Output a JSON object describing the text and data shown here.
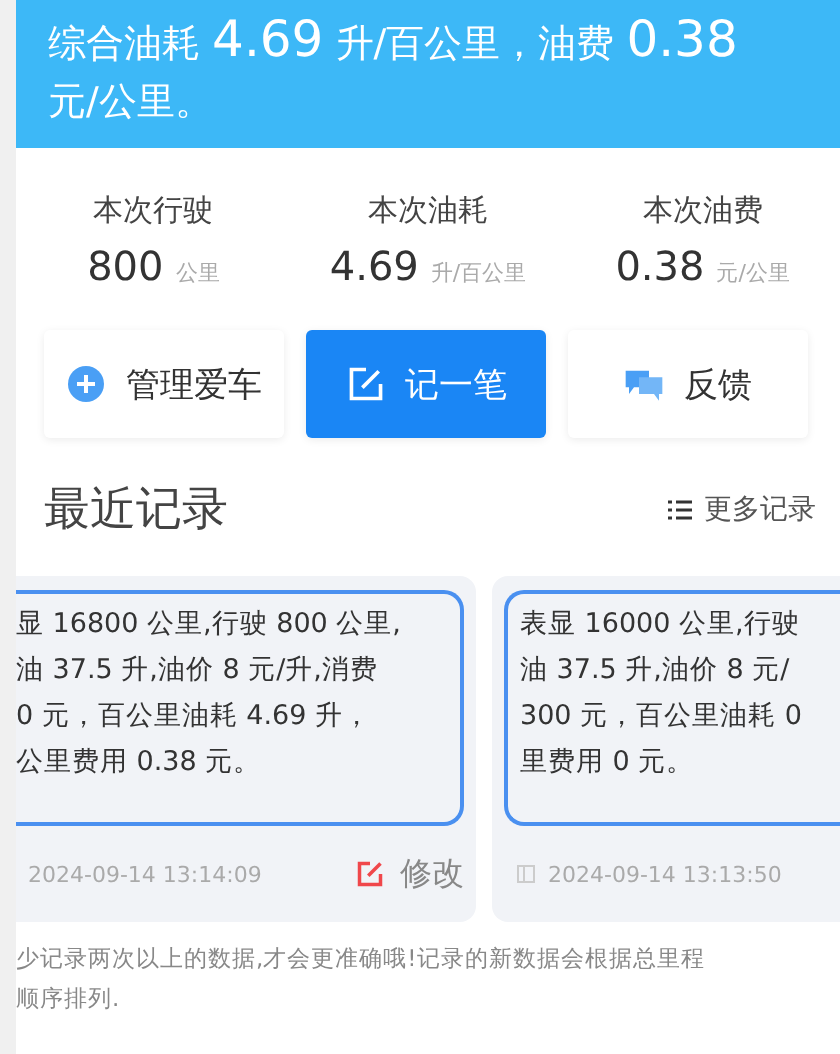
{
  "summary": {
    "segments": [
      {
        "text": "综合油耗 ",
        "kind": "label"
      },
      {
        "text": "4.69",
        "kind": "number"
      },
      {
        "text": " 升/百公里，油费 ",
        "kind": "label"
      },
      {
        "text": "0.38",
        "kind": "number"
      },
      {
        "text": " 元/公里。",
        "kind": "label"
      }
    ]
  },
  "stats": [
    {
      "label": "本次行驶",
      "value": "800",
      "unit": "公里"
    },
    {
      "label": "本次油耗",
      "value": "4.69",
      "unit": "升/百公里"
    },
    {
      "label": "本次油费",
      "value": "0.38",
      "unit": "元/公里"
    }
  ],
  "actions": [
    {
      "label": "管理爱车",
      "primary": false
    },
    {
      "label": "记一笔",
      "primary": true
    },
    {
      "label": "反馈",
      "primary": false
    }
  ],
  "section": {
    "title": "最近记录",
    "more": "更多记录"
  },
  "records": [
    {
      "lines": [
        "显 16800 公里,行驶 800 公里,",
        "油 37.5 升,油价 8 元/升,消费",
        "0 元，百公里油耗 4.69 升，",
        "公里费用 0.38 元。"
      ],
      "date": "2024-09-14 13:14:09",
      "action": "修改"
    },
    {
      "lines": [
        "表显 16000 公里,行驶",
        "油 37.5 升,油价 8 元/",
        "300 元，百公里油耗 0",
        "里费用 0 元。"
      ],
      "date": "2024-09-14 13:13:50"
    }
  ],
  "note": [
    "少记录两次以上的数据,才会更准确哦!记录的新数据会根据总里程",
    "顺序排列."
  ]
}
